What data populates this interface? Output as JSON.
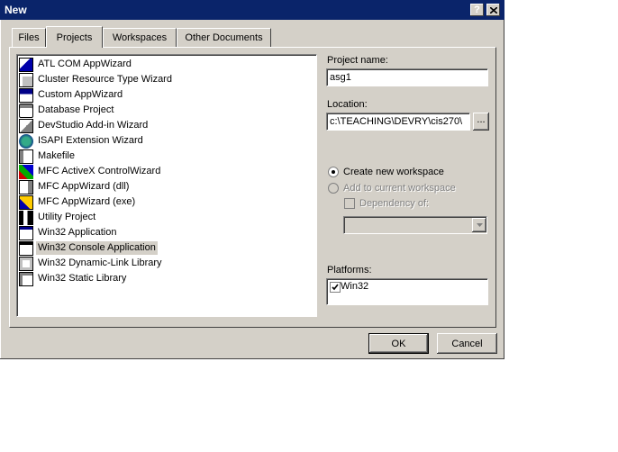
{
  "window": {
    "title": "New"
  },
  "titlebar": {
    "help_label": "?",
    "close_icon": "close-x-icon"
  },
  "tabs": [
    {
      "label": "Files",
      "active": false
    },
    {
      "label": "Projects",
      "active": true
    },
    {
      "label": "Workspaces",
      "active": false
    },
    {
      "label": "Other Documents",
      "active": false
    }
  ],
  "projects": [
    {
      "label": "ATL COM AppWizard",
      "icon": "atl-icon"
    },
    {
      "label": "Cluster Resource Type Wizard",
      "icon": "cluster-icon"
    },
    {
      "label": "Custom AppWizard",
      "icon": "custom-wizard-icon"
    },
    {
      "label": "Database Project",
      "icon": "database-icon"
    },
    {
      "label": "DevStudio Add-in Wizard",
      "icon": "addin-icon"
    },
    {
      "label": "ISAPI Extension Wizard",
      "icon": "globe-icon"
    },
    {
      "label": "Makefile",
      "icon": "makefile-icon"
    },
    {
      "label": "MFC ActiveX ControlWizard",
      "icon": "activex-icon"
    },
    {
      "label": "MFC AppWizard (dll)",
      "icon": "mfc-dll-icon"
    },
    {
      "label": "MFC AppWizard (exe)",
      "icon": "mfc-exe-icon"
    },
    {
      "label": "Utility Project",
      "icon": "utility-icon"
    },
    {
      "label": "Win32 Application",
      "icon": "win32-app-icon"
    },
    {
      "label": "Win32 Console Application",
      "icon": "console-icon",
      "selected": true
    },
    {
      "label": "Win32 Dynamic-Link Library",
      "icon": "dll-icon"
    },
    {
      "label": "Win32 Static Library",
      "icon": "static-lib-icon"
    }
  ],
  "form": {
    "project_name_label": "Project name:",
    "project_name_value": "asg1",
    "location_label": "Location:",
    "location_value": "c:\\TEACHING\\DEVRY\\cis270\\",
    "browse_label": "...",
    "create_new_label": "Create new workspace",
    "add_current_label": "Add to current workspace",
    "dependency_label": "Dependency of:",
    "dependency_value": "",
    "platforms_label": "Platforms:",
    "platforms": [
      {
        "label": "Win32",
        "checked": true
      }
    ]
  },
  "buttons": {
    "ok": "OK",
    "cancel": "Cancel"
  },
  "colors": {
    "title_bg": "#0a246a",
    "face": "#d4d0c8",
    "selection": "#d4d0c8"
  }
}
